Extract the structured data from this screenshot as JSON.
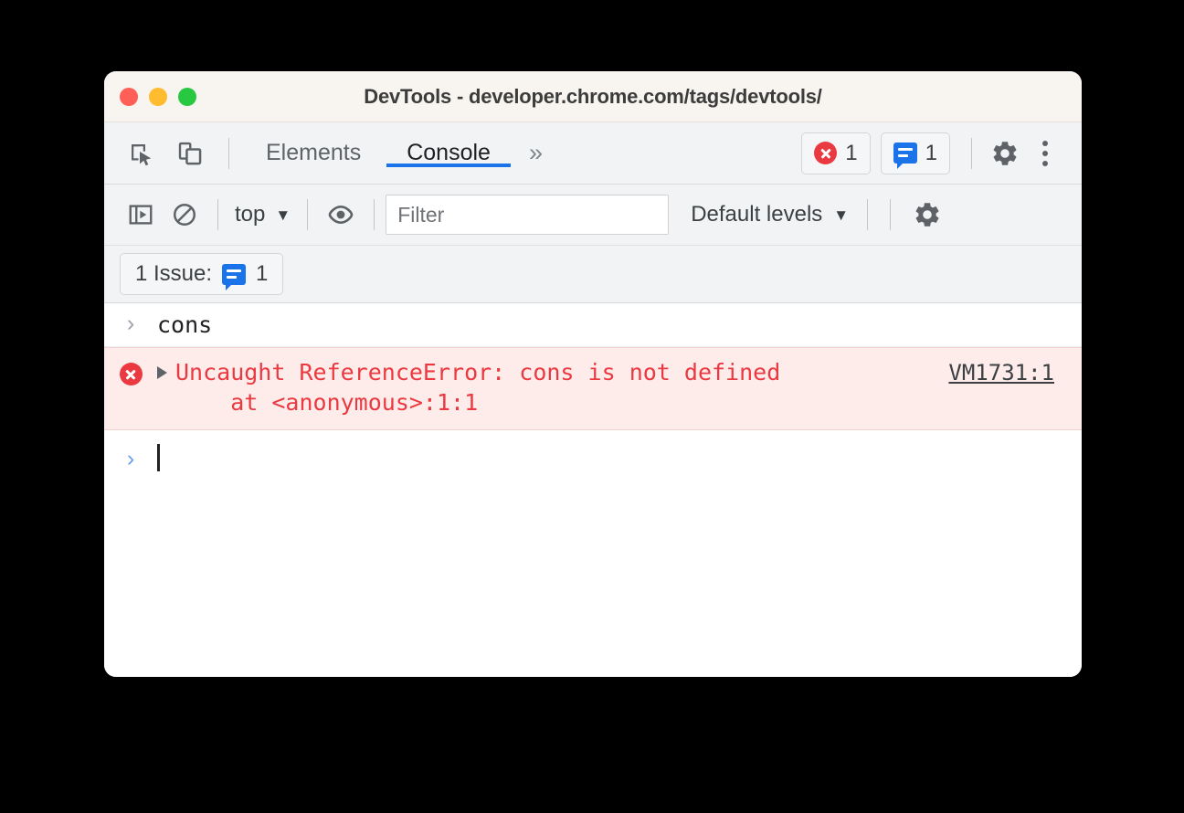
{
  "window": {
    "title": "DevTools - developer.chrome.com/tags/devtools/",
    "traffic_lights": [
      "close",
      "minimize",
      "maximize"
    ],
    "colors": {
      "close": "#FF5F57",
      "minimize": "#FEBC2E",
      "maximize": "#28C840",
      "titlebar_bg": "#F8F4EF",
      "toolbar_bg": "#F1F3F4",
      "accent_blue": "#1A73E8",
      "error_red": "#EB3941",
      "error_row_bg": "#FDECEA"
    }
  },
  "tabbar": {
    "inspect_icon": "inspect-element-icon",
    "device_icon": "device-toolbar-icon",
    "tabs": [
      {
        "label": "Elements",
        "active": false
      },
      {
        "label": "Console",
        "active": true
      }
    ],
    "more_tabs_label": "»",
    "error_count": "1",
    "message_count": "1",
    "settings_icon": "gear-icon",
    "menu_icon": "kebab-menu-icon"
  },
  "console_toolbar": {
    "sidebar_icon": "console-sidebar-icon",
    "clear_icon": "clear-console-icon",
    "context": "top",
    "context_caret": "▼",
    "eye_icon": "live-expression-eye-icon",
    "filter_placeholder": "Filter",
    "filter_value": "",
    "levels": "Default levels",
    "levels_caret": "▼",
    "settings_icon": "gear-icon"
  },
  "issues_bar": {
    "label": "1 Issue:",
    "icon": "message-bubble-icon",
    "count": "1"
  },
  "console": {
    "input_echo": {
      "chevron": "›",
      "text": "cons"
    },
    "error": {
      "icon": "error-circle-icon",
      "expander": "disclosure-triangle-icon",
      "line1": "Uncaught ReferenceError: cons is not defined",
      "line2": "    at <anonymous>:1:1",
      "source_link": "VM1731:1"
    },
    "prompt": {
      "chevron": "›",
      "value": ""
    }
  }
}
